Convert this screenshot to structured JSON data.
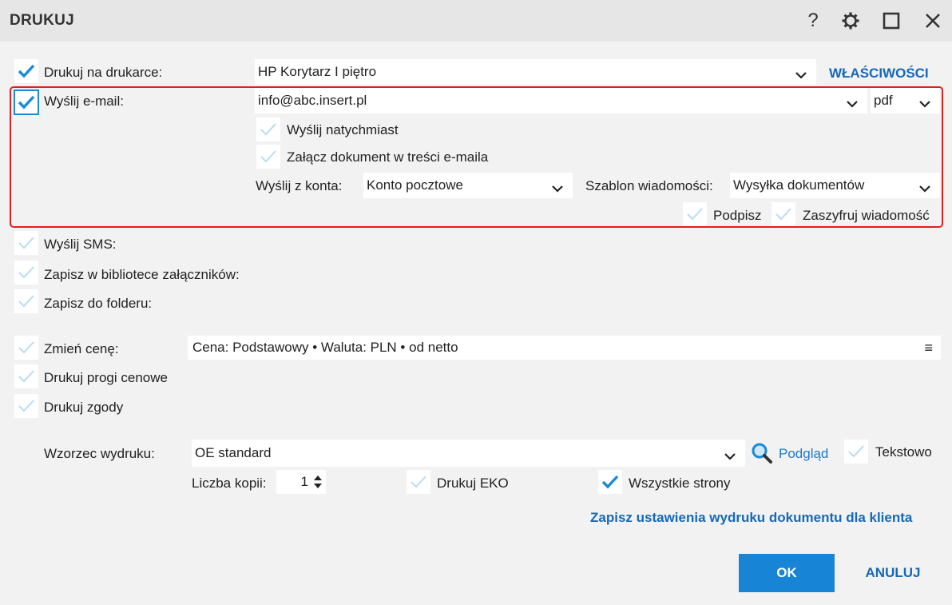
{
  "window": {
    "title": "DRUKUJ",
    "help_glyph": "?",
    "icons": [
      "help-icon",
      "gear-icon",
      "maximize-icon",
      "close-icon"
    ]
  },
  "printer": {
    "label": "Drukuj na drukarce:",
    "checked": true,
    "value": "HP Korytarz I piętro",
    "properties_link": "WŁAŚCIWOŚCI"
  },
  "email": {
    "label": "Wyślij e-mail:",
    "checked": true,
    "address": "info@abc.insert.pl",
    "format": "pdf",
    "send_now_label": "Wyślij natychmiast",
    "attach_label": "Załącz dokument w treści e-maila",
    "account_label": "Wyślij z konta:",
    "account_value": "Konto pocztowe",
    "template_label": "Szablon wiadomości:",
    "template_value": "Wysyłka dokumentów",
    "sign_label": "Podpisz",
    "encrypt_label": "Zaszyfruj wiadomość"
  },
  "options": {
    "sms_label": "Wyślij SMS:",
    "attachments_label": "Zapisz w bibliotece załączników:",
    "folder_label": "Zapisz do folderu:",
    "price_label": "Zmień cenę:",
    "price_value": "Cena: Podstawowy • Waluta: PLN • od netto",
    "price_menu_glyph": "≡",
    "thresholds_label": "Drukuj progi cenowe",
    "consents_label": "Drukuj zgody"
  },
  "template": {
    "label": "Wzorzec wydruku:",
    "value": "OE standard",
    "preview_link": "Podgląd",
    "text_label": "Tekstowo",
    "copies_label": "Liczba kopii:",
    "copies_value": "1",
    "eko_label": "Drukuj EKO",
    "all_pages_label": "Wszystkie strony",
    "all_pages_checked": true
  },
  "footer": {
    "save_settings_link": "Zapisz ustawienia wydruku dokumentu dla klienta",
    "ok": "OK",
    "cancel": "ANULUJ"
  },
  "colors": {
    "accent": "#1784d6",
    "highlight_border": "#e02020",
    "background": "#f2f2f2"
  }
}
